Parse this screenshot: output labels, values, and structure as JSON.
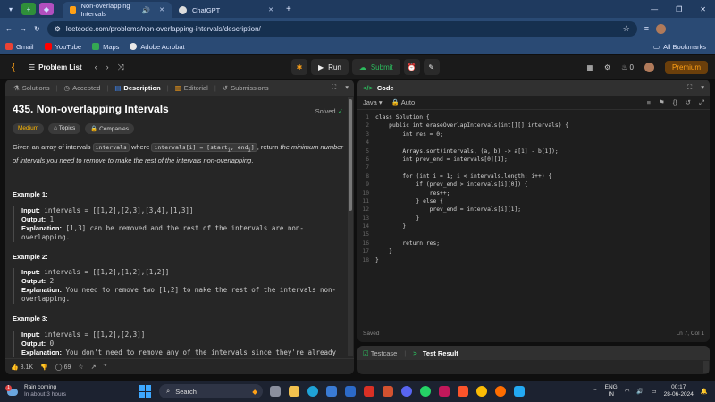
{
  "browser": {
    "tabs": [
      {
        "label": "Non-overlapping Intervals",
        "active": true
      },
      {
        "label": "ChatGPT",
        "active": false
      }
    ],
    "url": "leetcode.com/problems/non-overlapping-intervals/description/",
    "bookmarks": [
      "Gmail",
      "YouTube",
      "Maps",
      "Adobe Acrobat"
    ],
    "all_bookmarks": "All Bookmarks"
  },
  "nav": {
    "problem_list": "Problem List",
    "run": "Run",
    "submit": "Submit",
    "streak": "0",
    "premium": "Premium"
  },
  "left": {
    "tabs": [
      "Solutions",
      "Accepted",
      "Description",
      "Editorial",
      "Submissions"
    ],
    "title": "435. Non-overlapping Intervals",
    "solved": "Solved",
    "chips": [
      "Medium",
      "Topics",
      "Companies"
    ],
    "desc_a": "Given an array of intervals ",
    "desc_code1": "intervals",
    "desc_b": " where ",
    "desc_code2": "intervals[i] = [start",
    "desc_sub1": "i",
    "desc_code3": ", end",
    "desc_sub2": "i",
    "desc_code4": "]",
    "desc_c": ", return ",
    "desc_italic": "the minimum number of intervals you need to remove to make the rest of the intervals non-overlapping",
    "desc_d": ".",
    "examples": [
      {
        "heading": "Example 1:",
        "input_label": "Input:",
        "input": "intervals = [[1,2],[2,3],[3,4],[1,3]]",
        "output_label": "Output:",
        "output": "1",
        "expl_label": "Explanation:",
        "expl": "[1,3] can be removed and the rest of the intervals are non-overlapping."
      },
      {
        "heading": "Example 2:",
        "input_label": "Input:",
        "input": "intervals = [[1,2],[1,2],[1,2]]",
        "output_label": "Output:",
        "output": "2",
        "expl_label": "Explanation:",
        "expl": "You need to remove two [1,2] to make the rest of the intervals non-overlapping."
      },
      {
        "heading": "Example 3:",
        "input_label": "Input:",
        "input": "intervals = [[1,2],[2,3]]",
        "output_label": "Output:",
        "output": "0",
        "expl_label": "Explanation:",
        "expl": "You don't need to remove any of the intervals since they're already"
      }
    ],
    "likes": "8.1K",
    "comments": "69"
  },
  "right": {
    "title": "Code",
    "language": "Java",
    "mode": "Auto",
    "code_lines": [
      "class Solution {",
      "    public int eraseOverlapIntervals(int[][] intervals) {",
      "        int res = 0;",
      "",
      "        Arrays.sort(intervals, (a, b) -> a[1] - b[1]);",
      "        int prev_end = intervals[0][1];",
      "",
      "        for (int i = 1; i < intervals.length; i++) {",
      "            if (prev_end > intervals[i][0]) {",
      "                res++;",
      "            } else {",
      "                prev_end = intervals[i][1];",
      "            }",
      "        }",
      "",
      "        return res;",
      "    }",
      "}"
    ],
    "status": "Saved",
    "cursor": "Ln 7, Col 1"
  },
  "test": {
    "testcase": "Testcase",
    "result": "Test Result"
  },
  "taskbar": {
    "weather_title": "Rain coming",
    "weather_sub": "In about 3 hours",
    "search": "Search",
    "lang1": "ENG",
    "lang2": "IN",
    "time": "00:17",
    "date": "28-06-2024"
  },
  "colors": {
    "accent_orange": "#ffa116",
    "accent_green": "#2cbb5d",
    "medium": "#ffb800"
  }
}
